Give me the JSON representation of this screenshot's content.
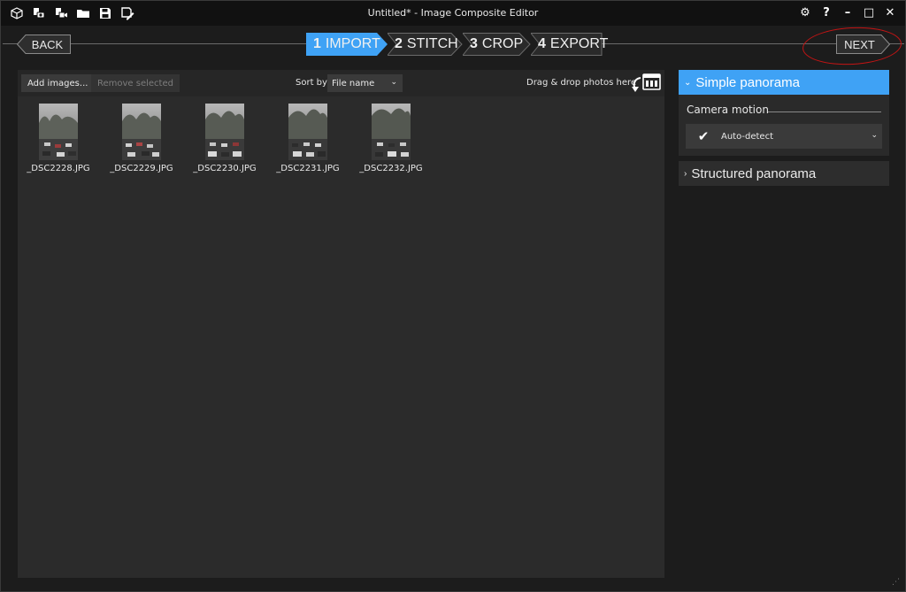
{
  "window": {
    "title": "Untitled* - Image Composite Editor",
    "controls": {
      "settings": "⚙",
      "help": "?",
      "minimize": "–",
      "maximize": "□",
      "close": "✕"
    }
  },
  "toolbar_icons": [
    "new-project-icon",
    "new-panorama-from-images-icon",
    "new-panorama-from-video-icon",
    "open-project-icon",
    "save-project-icon",
    "save-as-icon"
  ],
  "nav": {
    "back_label": "BACK",
    "next_label": "NEXT",
    "steps": [
      {
        "num": "1",
        "label": "IMPORT",
        "active": true
      },
      {
        "num": "2",
        "label": "STITCH",
        "active": false
      },
      {
        "num": "3",
        "label": "CROP",
        "active": false
      },
      {
        "num": "4",
        "label": "EXPORT",
        "active": false
      }
    ]
  },
  "import_toolbar": {
    "add_images": "Add images...",
    "remove_selected": "Remove selected",
    "sort_label": "Sort by",
    "sort_value": "File name",
    "drag_drop": "Drag & drop photos here"
  },
  "images": [
    {
      "name": "_DSC2228.JPG"
    },
    {
      "name": "_DSC2229.JPG"
    },
    {
      "name": "_DSC2230.JPG"
    },
    {
      "name": "_DSC2231.JPG"
    },
    {
      "name": "_DSC2232.JPG"
    }
  ],
  "side_panel": {
    "simple": {
      "label": "Simple panorama",
      "expanded": true
    },
    "camera_motion_label": "Camera motion",
    "camera_motion_value": "Auto-detect",
    "structured": {
      "label": "Structured panorama",
      "expanded": false
    }
  },
  "colors": {
    "accent": "#3fa2f5",
    "annotation_ring": "#c41414"
  }
}
